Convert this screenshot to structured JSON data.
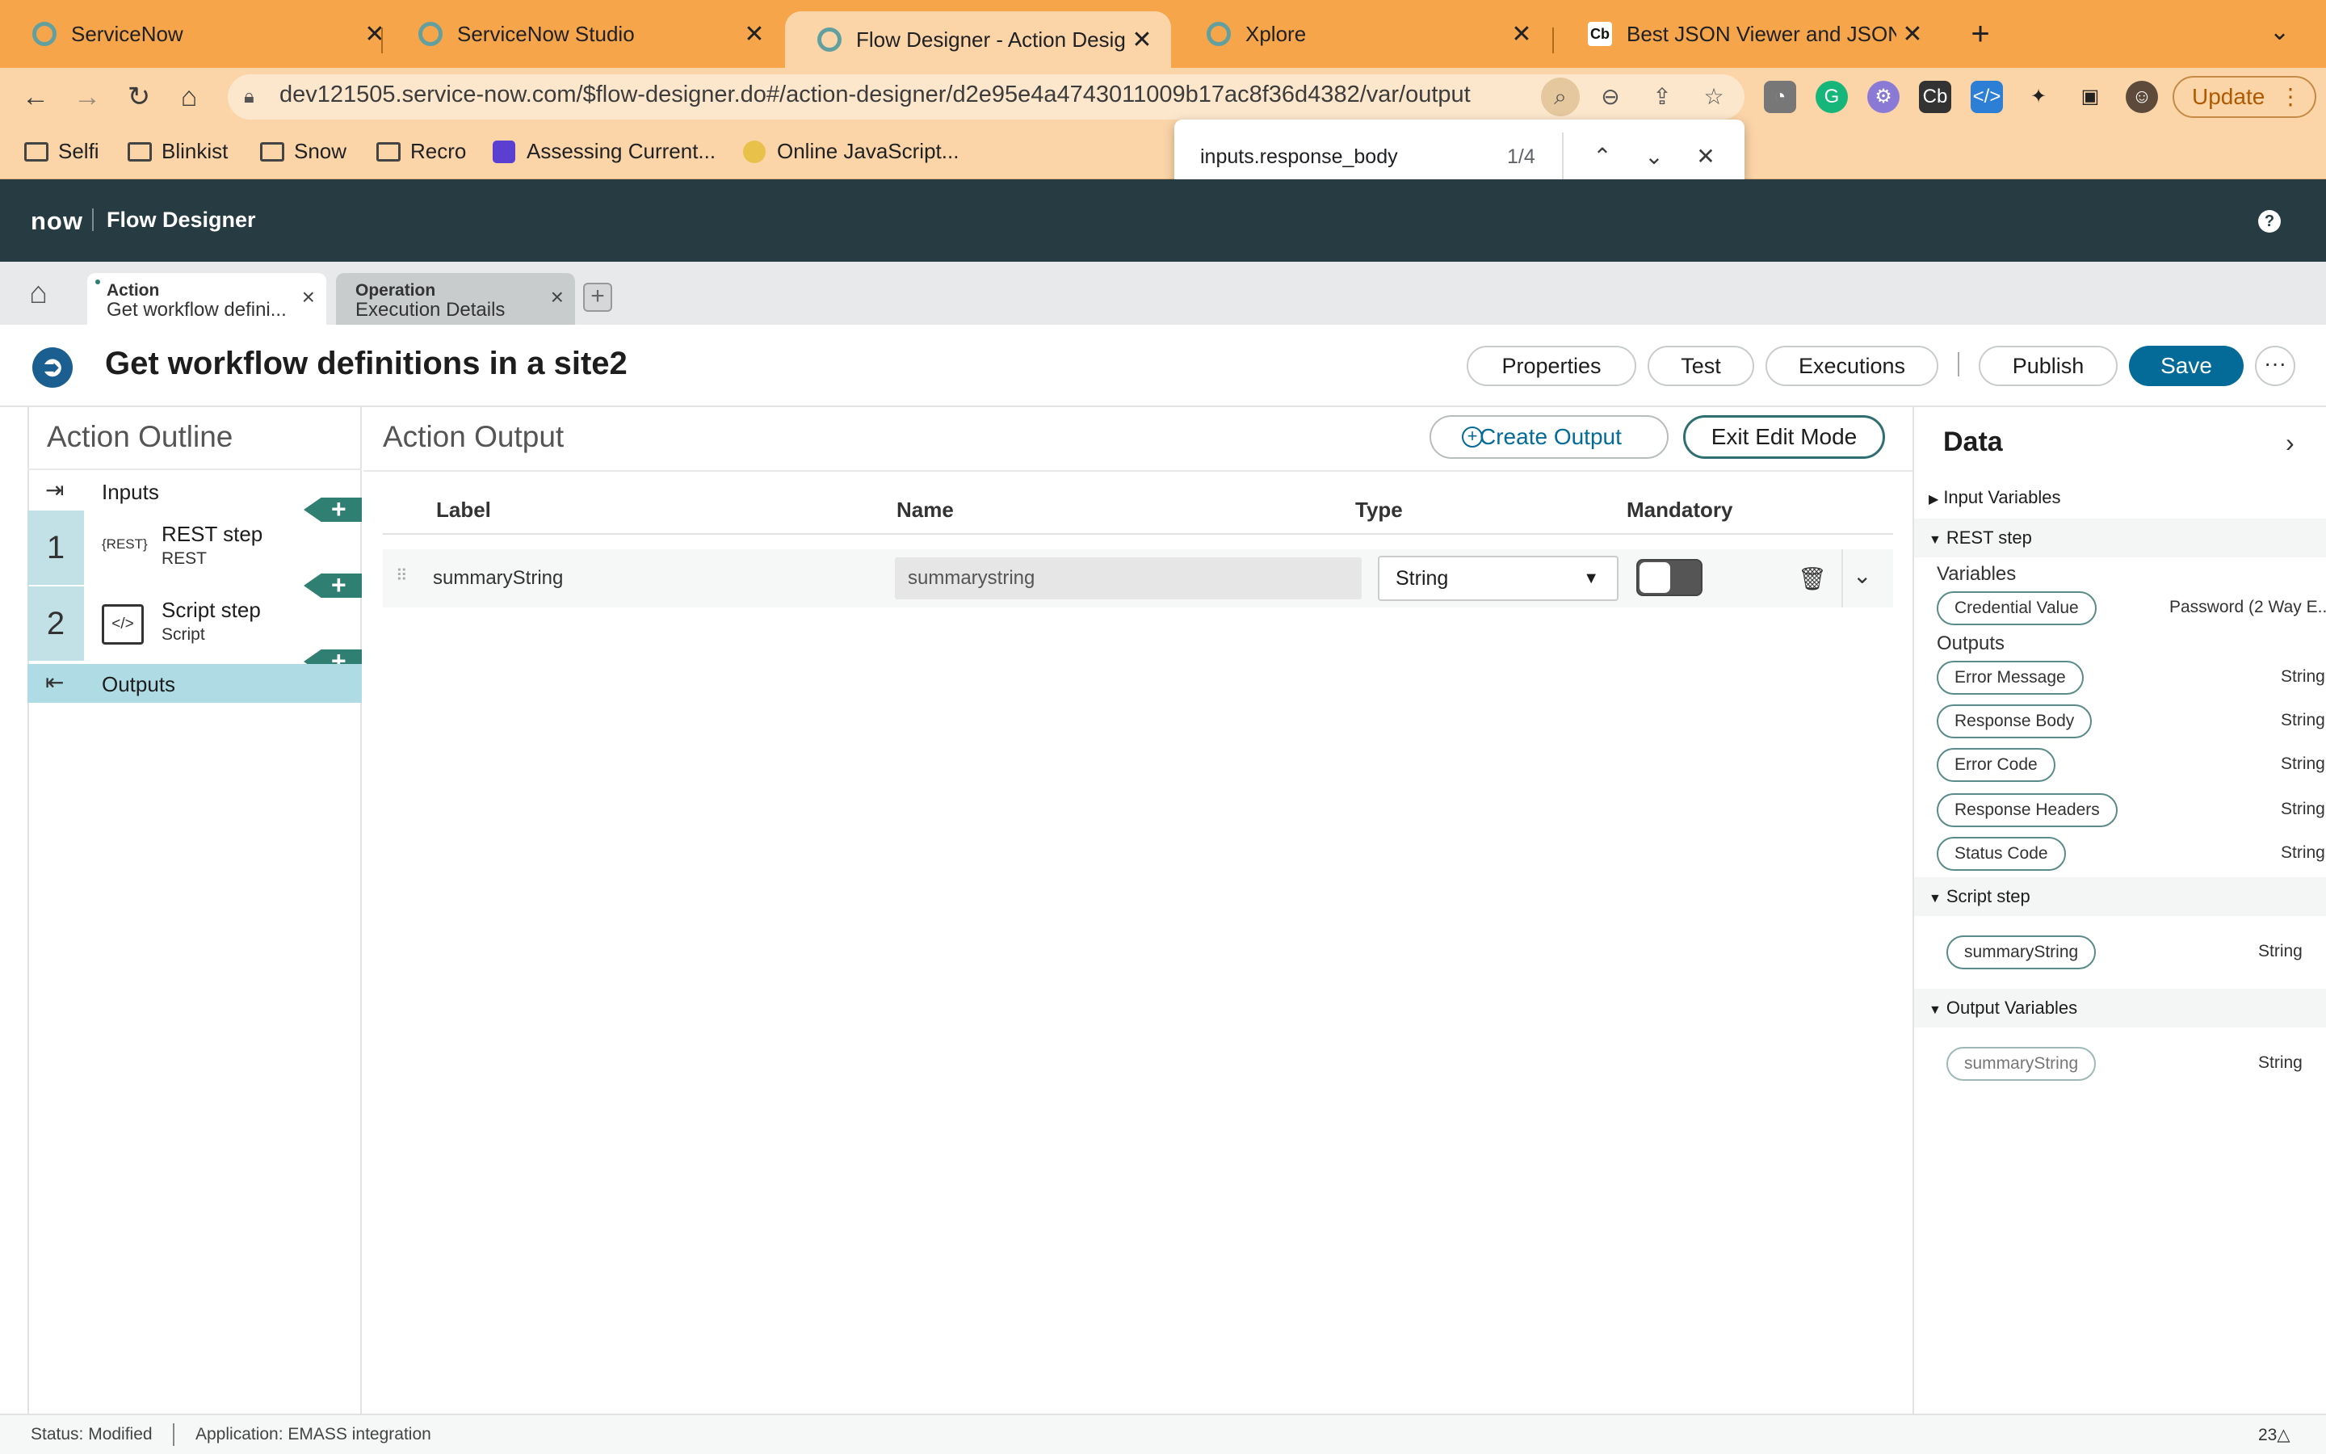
{
  "browser": {
    "tabs": [
      {
        "title": "ServiceNow",
        "close": "✕"
      },
      {
        "title": "ServiceNow Studio",
        "close": "✕"
      },
      {
        "title": "Flow Designer - Action Designer",
        "close": "✕"
      },
      {
        "title": "Xplore",
        "close": "✕"
      },
      {
        "title": "Best JSON Viewer and JSON Beautifier",
        "close": "✕",
        "icon_text": "Cb"
      }
    ],
    "new_tab": "+",
    "url": "dev121505.service-now.com/$flow-designer.do#/action-designer/d2e95e4a4743011009b17ac8f36d4382/var/output",
    "update_label": "Update",
    "bookmarks": [
      "Selfi",
      "Blinkist",
      "Snow",
      "Recro",
      "Assessing Current...",
      "Online JavaScript..."
    ],
    "find": {
      "query": "inputs.response_body",
      "count": "1/4"
    }
  },
  "app": {
    "logo": "now",
    "title": "Flow Designer",
    "help": "?",
    "page_tabs": [
      {
        "type": "Action",
        "name": "Get workflow defini..."
      },
      {
        "type": "Operation",
        "name": "Execution Details"
      }
    ]
  },
  "action": {
    "title": "Get workflow definitions in a site2",
    "buttons": {
      "properties": "Properties",
      "test": "Test",
      "executions": "Executions",
      "publish": "Publish",
      "save": "Save",
      "more": "···"
    }
  },
  "outline": {
    "title": "Action Outline",
    "inputs": "Inputs",
    "steps": [
      {
        "num": "1",
        "icon_text": "{REST}",
        "name": "REST step",
        "type": "REST"
      },
      {
        "num": "2",
        "icon_text": "</>",
        "name": "Script step",
        "type": "Script"
      }
    ],
    "outputs": "Outputs",
    "add": "+"
  },
  "output_table": {
    "title": "Action Output",
    "create_label": "Create Output",
    "exit_label": "Exit Edit Mode",
    "columns": [
      "Label",
      "Name",
      "Type",
      "Mandatory"
    ],
    "rows": [
      {
        "label": "summaryString",
        "name": "summarystring",
        "type": "String",
        "mandatory": false
      }
    ]
  },
  "data_panel": {
    "title": "Data",
    "input_variables": "Input Variables",
    "rest_step": "REST step",
    "variables_label": "Variables",
    "variables": [
      {
        "name": "Credential Value",
        "type": "Password (2 Way E..."
      }
    ],
    "outputs_label": "Outputs",
    "outputs": [
      {
        "name": "Error Message",
        "type": "String"
      },
      {
        "name": "Response Body",
        "type": "String"
      },
      {
        "name": "Error Code",
        "type": "String"
      },
      {
        "name": "Response Headers",
        "type": "String"
      },
      {
        "name": "Status Code",
        "type": "String"
      }
    ],
    "script_step": "Script step",
    "script_outputs": [
      {
        "name": "summaryString",
        "type": "String"
      }
    ],
    "output_variables": "Output Variables",
    "output_vars": [
      {
        "name": "summaryString",
        "type": "String"
      }
    ]
  },
  "status": {
    "state": "Status: Modified",
    "application": "Application: EMASS integration",
    "count": "23"
  },
  "colors": {
    "header": "#263c42",
    "accent": "#046b99",
    "chrome": "#f6a54a",
    "step_flag": "#2f8072"
  }
}
